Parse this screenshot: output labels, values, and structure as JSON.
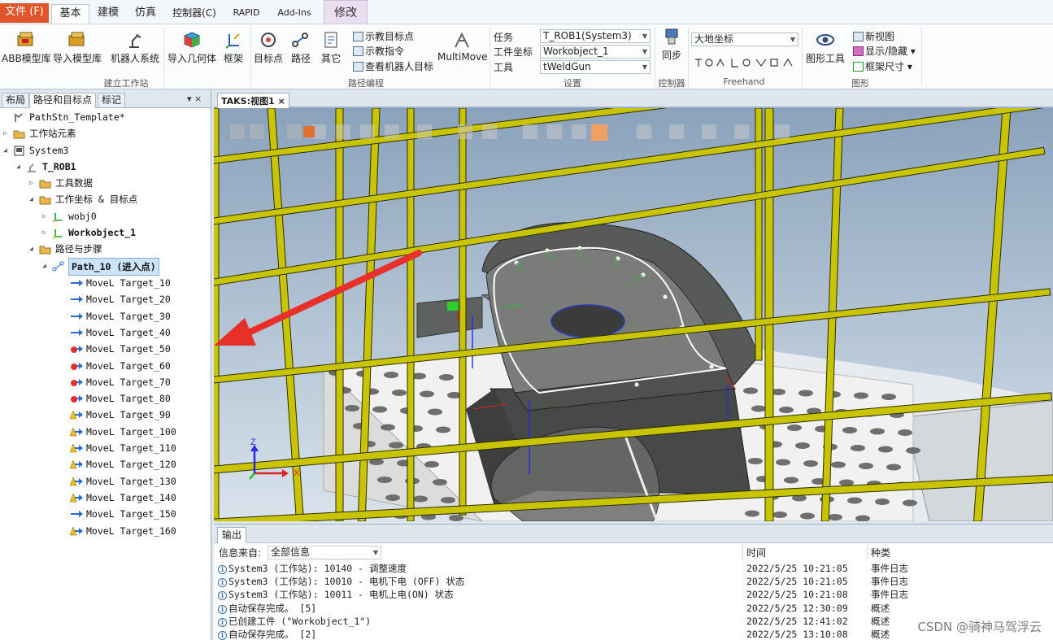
{
  "ribbon_tabs": {
    "file": "文件 (F)",
    "basic": "基本",
    "modeling": "建模",
    "simulation": "仿真",
    "controller": "控制器(C)",
    "rapid": "RAPID",
    "addins": "Add-Ins",
    "modify": "修改"
  },
  "ribbon": {
    "abb_library": "ABB模型库",
    "import_library": "导入模型库",
    "robot_system": "机器人系统",
    "import_geometry": "导入几何体",
    "frame": "框架",
    "group_build": "建立工作站",
    "target": "目标点",
    "path": "路径",
    "other": "其它",
    "teach_target": "示教目标点",
    "teach_instruction": "示教指令",
    "view_robot_target": "查看机器人目标",
    "multimove": "MultiMove",
    "group_path": "路径编程",
    "task_label": "任务",
    "task_value": "T_ROB1(System3)",
    "wobj_label": "工件坐标",
    "wobj_value": "Workobject_1",
    "tool_label": "工具",
    "tool_value": "tWeldGun",
    "group_settings": "设置",
    "sync": "同步",
    "group_controller": "控制器",
    "coord_value": "大地坐标",
    "group_freehand": "Freehand",
    "graphics_tools": "图形工具",
    "new_view": "新视图",
    "show_hide": "显示/隐藏",
    "frame_size": "框架尺寸",
    "group_graphics": "图形"
  },
  "left_panel": {
    "tabs": [
      "布局",
      "路径和目标点",
      "标记"
    ],
    "pin": "▾ ×",
    "tree": {
      "station": "PathStn_Template*",
      "station_elements": "工作站元素",
      "system": "System3",
      "task": "T_ROB1",
      "tool_data": "工具数据",
      "wobj_targets": "工作坐标 & 目标点",
      "wobj0": "wobj0",
      "workobject1": "Workobject_1",
      "paths": "路径与步骤",
      "path10": "Path_10 (进入点)"
    },
    "instructions": [
      {
        "text": "MoveL Target_10",
        "state": "ok"
      },
      {
        "text": "MoveL Target_20",
        "state": "ok"
      },
      {
        "text": "MoveL Target_30",
        "state": "ok"
      },
      {
        "text": "MoveL Target_40",
        "state": "ok"
      },
      {
        "text": "MoveL Target_50",
        "state": "error"
      },
      {
        "text": "MoveL Target_60",
        "state": "error"
      },
      {
        "text": "MoveL Target_70",
        "state": "error"
      },
      {
        "text": "MoveL Target_80",
        "state": "error"
      },
      {
        "text": "MoveL Target_90",
        "state": "warn"
      },
      {
        "text": "MoveL Target_100",
        "state": "warn"
      },
      {
        "text": "MoveL Target_110",
        "state": "warn"
      },
      {
        "text": "MoveL Target_120",
        "state": "warn"
      },
      {
        "text": "MoveL Target_130",
        "state": "warn"
      },
      {
        "text": "MoveL Target_140",
        "state": "warn"
      },
      {
        "text": "MoveL Target_150",
        "state": "ok"
      },
      {
        "text": "MoveL Target_160",
        "state": "warn"
      }
    ]
  },
  "document": {
    "tab": "TAKS:视图1",
    "close": "×"
  },
  "viewport": {
    "axis_x": "X",
    "axis_z": "Z"
  },
  "output": {
    "tab": "输出",
    "source_label": "信息来自:",
    "source_value": "全部信息",
    "col_time": "时间",
    "col_type": "种类",
    "rows": [
      {
        "msg": "System3 (工作站): 10140 - 调整速度",
        "time": "2022/5/25 10:21:05",
        "type": "事件日志"
      },
      {
        "msg": "System3 (工作站): 10010 - 电机下电 (OFF) 状态",
        "time": "2022/5/25 10:21:05",
        "type": "事件日志"
      },
      {
        "msg": "System3 (工作站): 10011 - 电机上电(ON) 状态",
        "time": "2022/5/25 10:21:08",
        "type": "事件日志"
      },
      {
        "msg": "自动保存完成。 [5]",
        "time": "2022/5/25 12:30:09",
        "type": "概述"
      },
      {
        "msg": "已创建工件 (\"Workobject_1\")",
        "time": "2022/5/25 12:41:02",
        "type": "概述"
      },
      {
        "msg": "自动保存完成。 [2]",
        "time": "2022/5/25 13:10:08",
        "type": "概述"
      }
    ],
    "watermark": "CSDN @骑神马驾浮云"
  },
  "colors": {
    "file_tab": "#e0562a",
    "fence": "#c8c400",
    "arrow": "#e8302a",
    "path_line": "#ffffff",
    "part": "#6f7270"
  }
}
